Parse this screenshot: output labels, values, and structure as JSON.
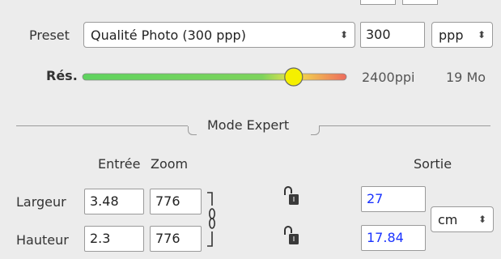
{
  "preset": {
    "label": "Preset",
    "value": "Qualité Photo (300 ppp)",
    "resolution_value": "300",
    "unit_value": "ppp"
  },
  "resolution": {
    "label": "Rés.",
    "slider_level_percent": 80,
    "ppi_text": "2400ppi",
    "size_text": "19 Mo"
  },
  "section": {
    "title": "Mode Expert"
  },
  "columns": {
    "entree": "Entrée",
    "zoom": "Zoom",
    "sortie": "Sortie"
  },
  "rows": {
    "width": {
      "label": "Largeur",
      "entree": "3.48",
      "zoom": "776",
      "sortie": "27"
    },
    "height": {
      "label": "Hauteur",
      "entree": "2.3",
      "zoom": "776",
      "sortie": "17.84"
    }
  },
  "output_unit": "cm",
  "colors": {
    "output_text": "#1a33ff",
    "slider_knob": "#f5f000"
  },
  "icons": [
    "chain-link-icon",
    "lock-open-icon",
    "updown-arrows-icon"
  ]
}
